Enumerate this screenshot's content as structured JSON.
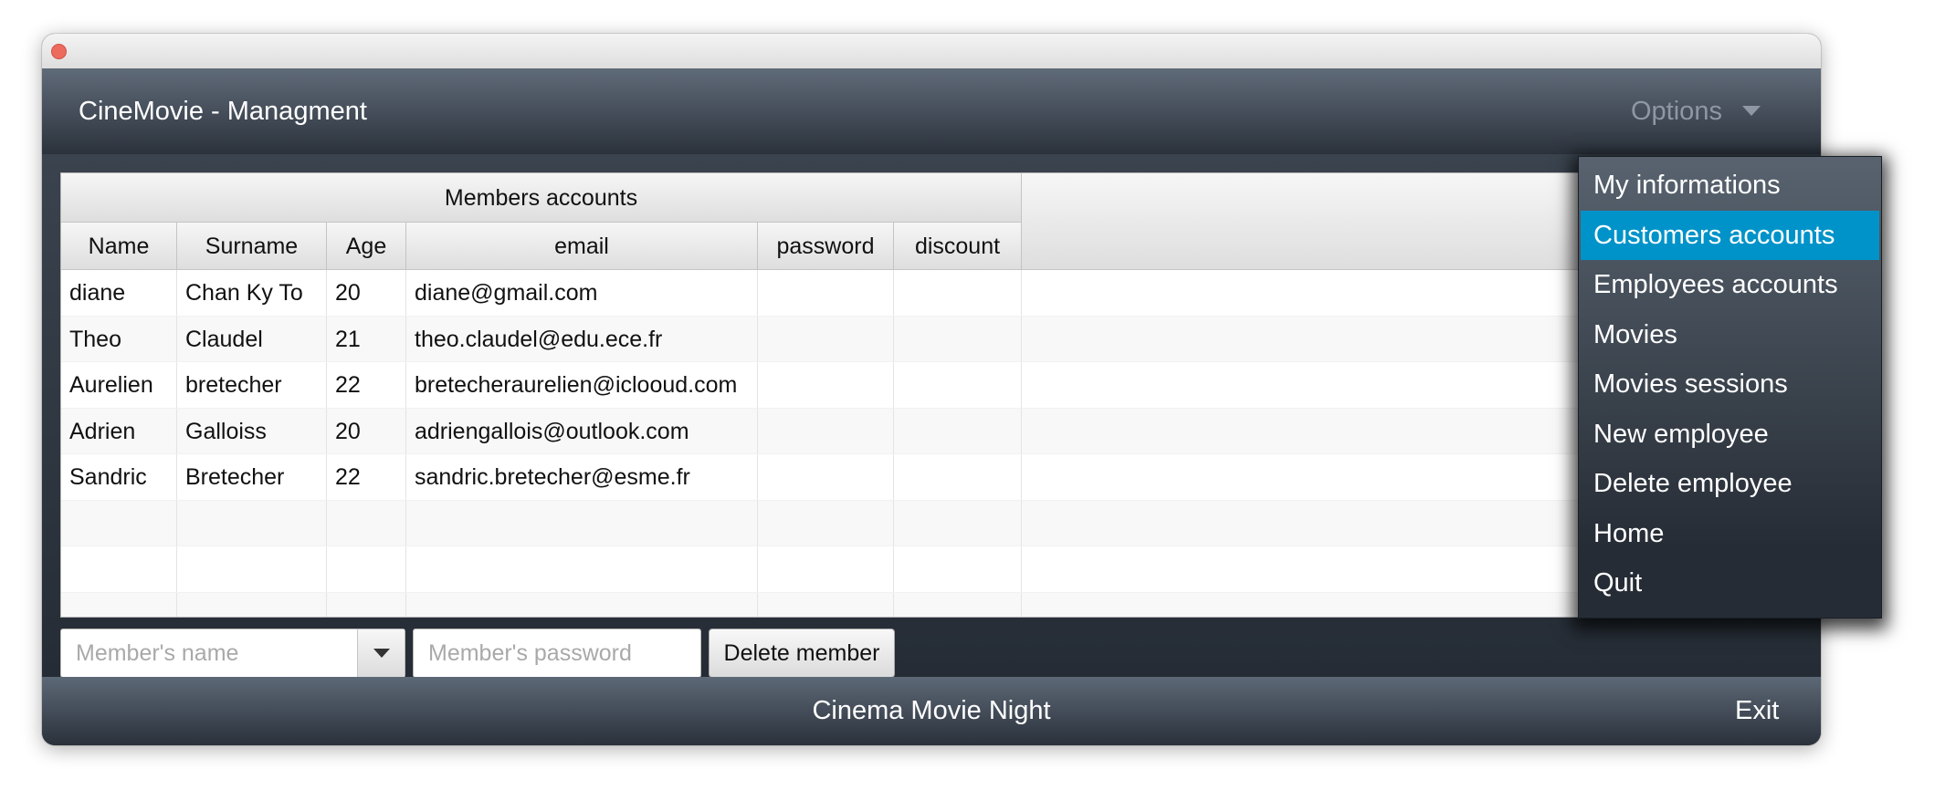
{
  "header": {
    "title": "CineMovie - Managment",
    "options_label": "Options"
  },
  "table": {
    "group_header": "Members accounts",
    "columns": [
      "Name",
      "Surname",
      "Age",
      "email",
      "password",
      "discount"
    ],
    "rows": [
      [
        "diane",
        "Chan Ky To",
        "20",
        "diane@gmail.com",
        "",
        ""
      ],
      [
        "Theo",
        "Claudel",
        "21",
        "theo.claudel@edu.ece.fr",
        "",
        ""
      ],
      [
        "Aurelien",
        "bretecher",
        "22",
        "bretecheraurelien@iclooud.com",
        "",
        ""
      ],
      [
        "Adrien",
        "Galloiss",
        "20",
        "adriengallois@outlook.com",
        "",
        ""
      ],
      [
        "Sandric",
        "Bretecher",
        "22",
        "sandric.bretecher@esme.fr",
        "",
        ""
      ],
      [
        "",
        "",
        "",
        "",
        "",
        ""
      ],
      [
        "",
        "",
        "",
        "",
        "",
        ""
      ],
      [
        "",
        "",
        "",
        "",
        "",
        ""
      ]
    ]
  },
  "controls": {
    "member_name_placeholder": "Member's name",
    "member_password_placeholder": "Member's password",
    "delete_label": "Delete member"
  },
  "footer": {
    "title": "Cinema Movie Night",
    "exit_label": "Exit"
  },
  "options_menu": {
    "items": [
      {
        "label": "My informations",
        "selected": false
      },
      {
        "label": "Customers accounts",
        "selected": true
      },
      {
        "label": "Employees accounts",
        "selected": false
      },
      {
        "label": "Movies",
        "selected": false
      },
      {
        "label": "Movies sessions",
        "selected": false
      },
      {
        "label": "New employee",
        "selected": false
      },
      {
        "label": "Delete employee",
        "selected": false
      },
      {
        "label": "Home",
        "selected": false
      },
      {
        "label": "Quit",
        "selected": false
      }
    ]
  },
  "colors": {
    "menu_highlight": "#0093c9",
    "close_button": "#ed6a5e",
    "header_dark": "#2b323c"
  }
}
